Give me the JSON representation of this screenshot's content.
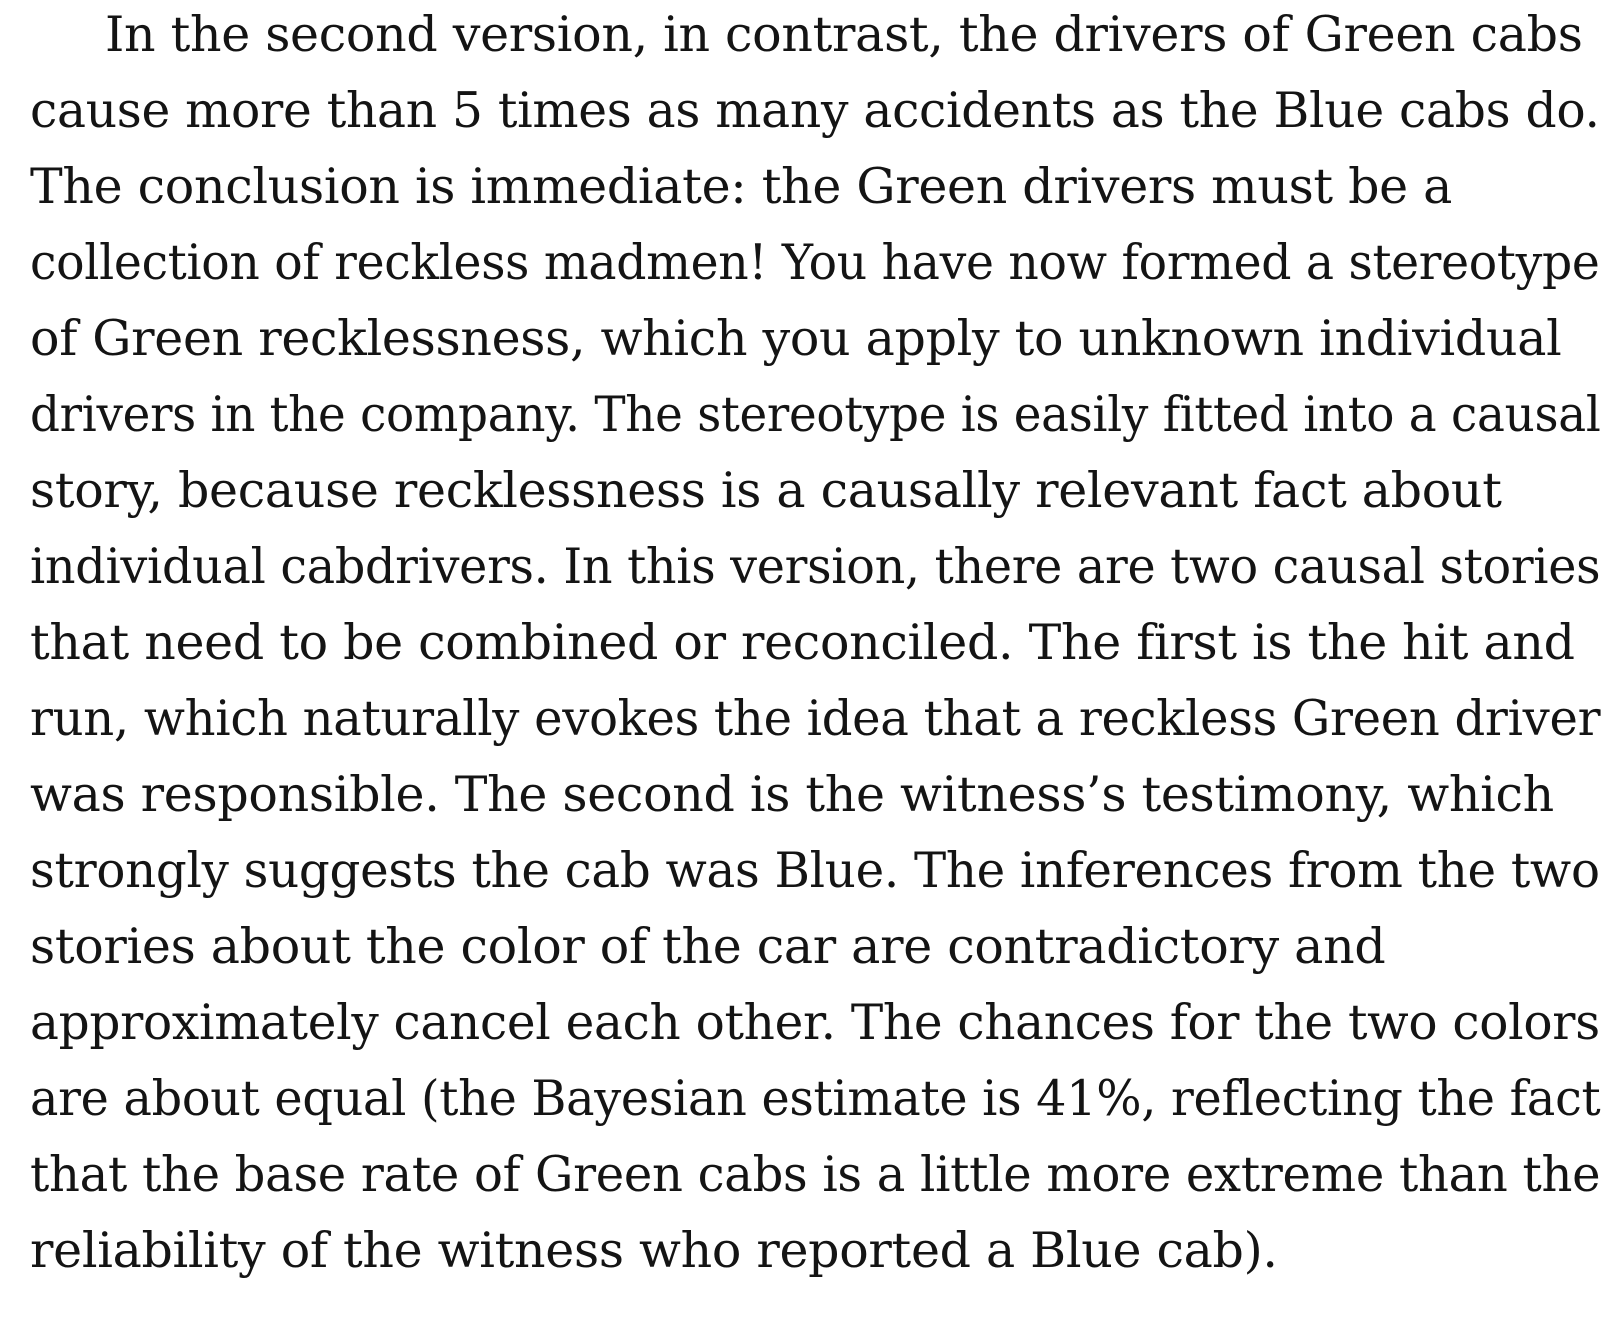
{
  "document": {
    "paragraph_lines": [
      "In the second version, in contrast, the drivers of Green cabs",
      "cause more than 5 times as many accidents as the Blue cabs do.",
      "The conclusion is immediate: the Green drivers must be a",
      "collection of reckless madmen! You have now formed a stereotype",
      "of Green recklessness, which you apply to unknown individual",
      "drivers in the company. The stereotype is easily fitted into a causal",
      "story, because recklessness is a causally relevant fact about",
      "individual cabdrivers. In this version, there are two causal stories",
      "that need to be combined or reconciled. The first is the hit and",
      "run, which naturally evokes the idea that a reckless Green driver",
      "was responsible. The second is the witness’s testimony, which",
      "strongly suggests the cab was Blue. The inferences from the two",
      "stories about the color of the car are contradictory and",
      "approximately cancel each other. The chances for the two colors",
      "are about equal (the Bayesian estimate is 41%, reflecting the fact",
      "that the base rate of Green cabs is a little more extreme than the",
      "reliability of the witness who reported a Blue cab)."
    ]
  }
}
